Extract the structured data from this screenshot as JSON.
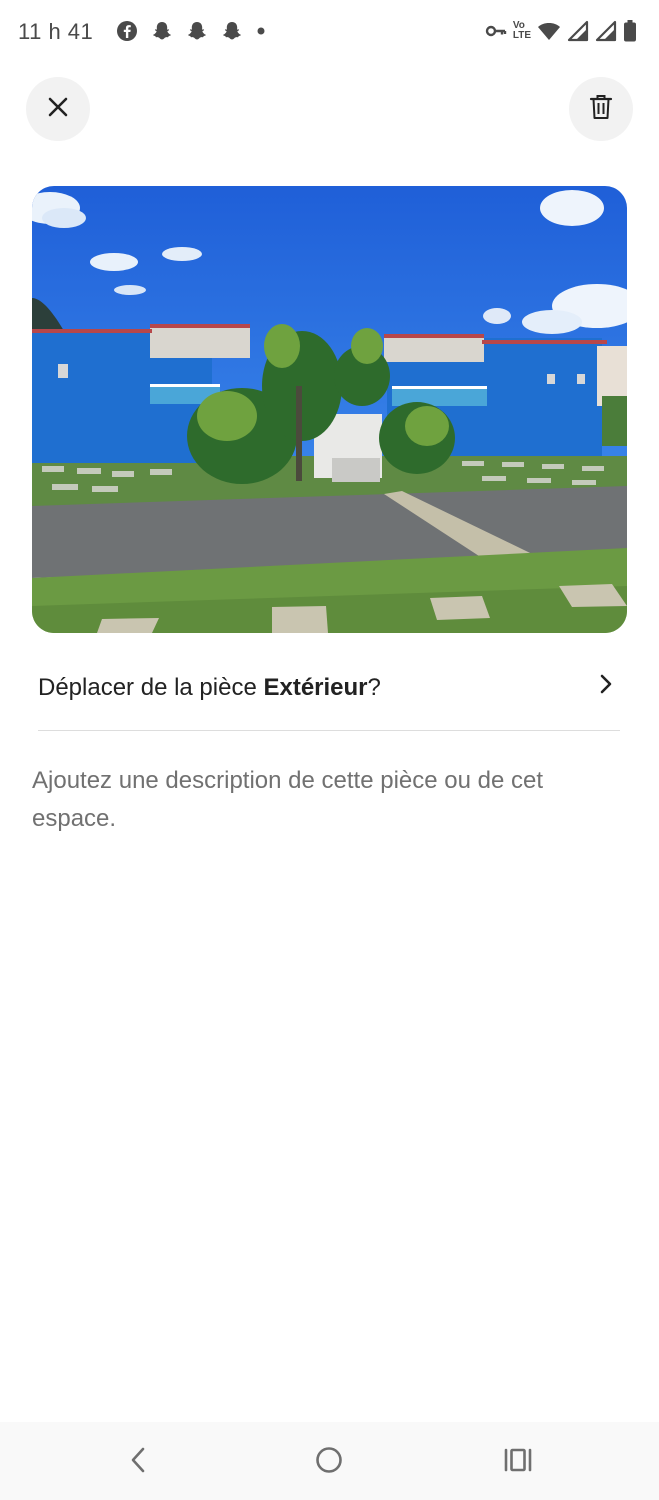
{
  "status_bar": {
    "time": "11 h 41",
    "left_icons": [
      "facebook-icon",
      "snapchat-icon",
      "snapchat-icon",
      "snapchat-icon",
      "dot-icon"
    ],
    "right_icons": [
      "vpn-key-icon",
      "volte-icon",
      "wifi-icon",
      "signal-icon",
      "signal-icon",
      "battery-icon"
    ],
    "volte_top": "Vo",
    "volte_bottom": "LTE"
  },
  "header": {
    "close_icon": "close-icon",
    "delete_icon": "trash-icon"
  },
  "photo": {
    "subject": "blue-building-with-palm-trees"
  },
  "move_room": {
    "prefix": "Déplacer de la pièce ",
    "room": "Extérieur",
    "suffix": "?"
  },
  "description": {
    "placeholder": "Ajoutez une description de cette pièce ou de cet espace."
  },
  "nav_bar": {
    "icons": [
      "back-icon",
      "home-icon",
      "recents-icon"
    ]
  }
}
